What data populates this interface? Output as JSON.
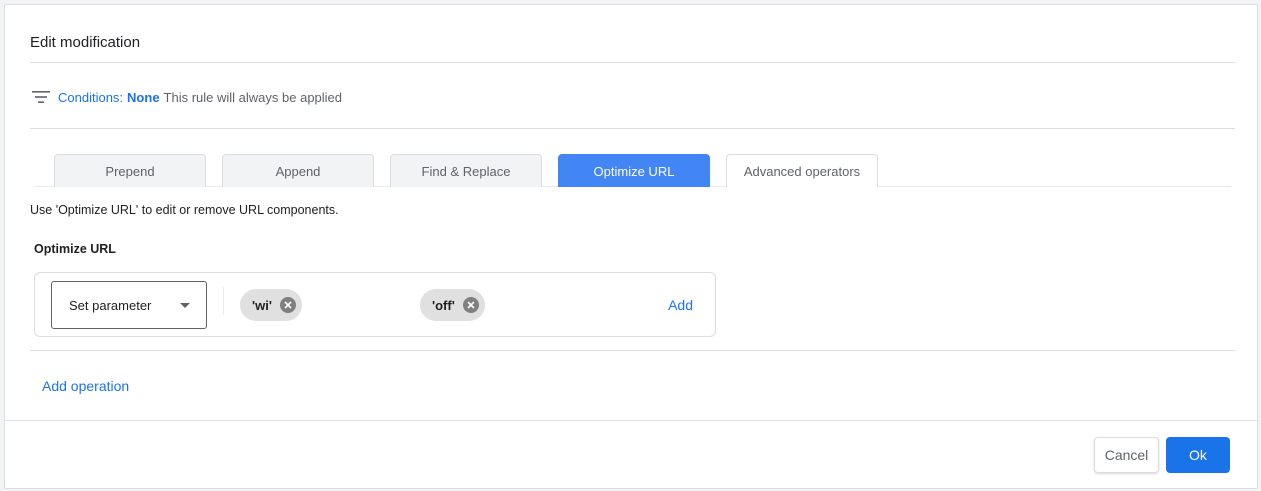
{
  "dialog": {
    "title": "Edit modification",
    "conditions": {
      "icon": "filter-list-icon",
      "label": "Conditions:",
      "value": "None",
      "description": "This rule will always be applied"
    },
    "tabs": [
      {
        "label": "Prepend",
        "active": false
      },
      {
        "label": "Append",
        "active": false
      },
      {
        "label": "Find & Replace",
        "active": false
      },
      {
        "label": "Optimize URL",
        "active": true
      },
      {
        "label": "Advanced operators",
        "active": false
      }
    ],
    "help_text": "Use 'Optimize URL' to edit or remove URL components.",
    "section_label": "Optimize URL",
    "operation": {
      "select_value": "Set parameter",
      "chips": [
        "'wi'",
        "'off'"
      ],
      "add_label": "Add"
    },
    "add_operation_label": "Add operation",
    "buttons": {
      "cancel": "Cancel",
      "ok": "Ok"
    }
  },
  "colors": {
    "accent": "#1a73e8",
    "active_tab": "#4285f4",
    "chip_bg": "#e0e0e0"
  }
}
